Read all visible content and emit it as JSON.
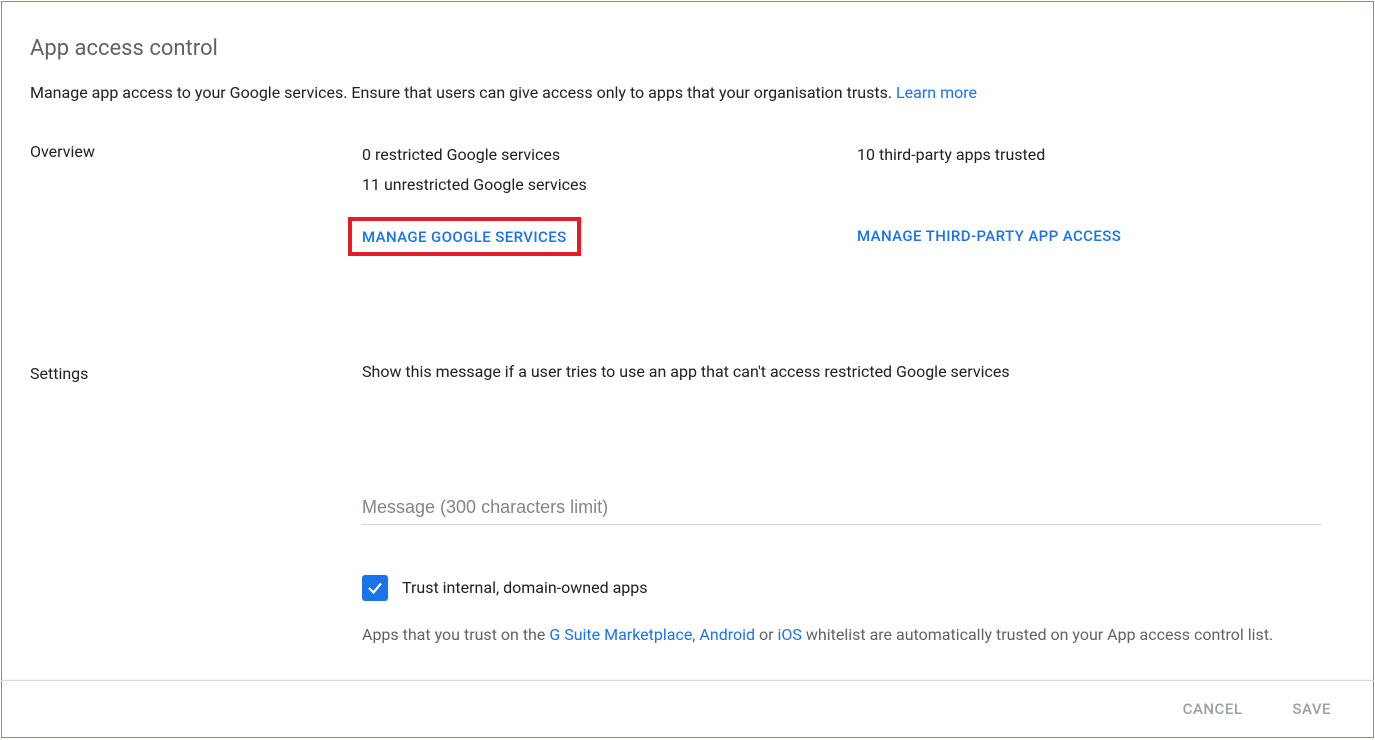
{
  "title": "App access control",
  "intro": {
    "text": "Manage app access to your Google services. Ensure that users can give access only to apps that your organisation trusts. ",
    "learn_more": "Learn more"
  },
  "overview": {
    "label": "Overview",
    "restricted": "0 restricted Google services",
    "unrestricted": "11 unrestricted Google services",
    "trusted": "10 third-party apps trusted",
    "manage_services_btn": "MANAGE GOOGLE SERVICES",
    "manage_third_party_btn": "MANAGE THIRD-PARTY APP ACCESS"
  },
  "settings": {
    "label": "Settings",
    "message_label": "Show this message if a user tries to use an app that can't access restricted Google services",
    "message_placeholder": "Message (300 characters limit)",
    "trust_internal_label": "Trust internal, domain-owned apps",
    "trust_desc_prefix": "Apps that you trust on the ",
    "gsuite_link": "G Suite Marketplace",
    "comma": ", ",
    "android_link": "Android",
    "or": " or ",
    "ios_link": "iOS",
    "trust_desc_suffix": " whitelist are automatically trusted on your App access control list."
  },
  "footer": {
    "cancel": "CANCEL",
    "save": "SAVE"
  }
}
